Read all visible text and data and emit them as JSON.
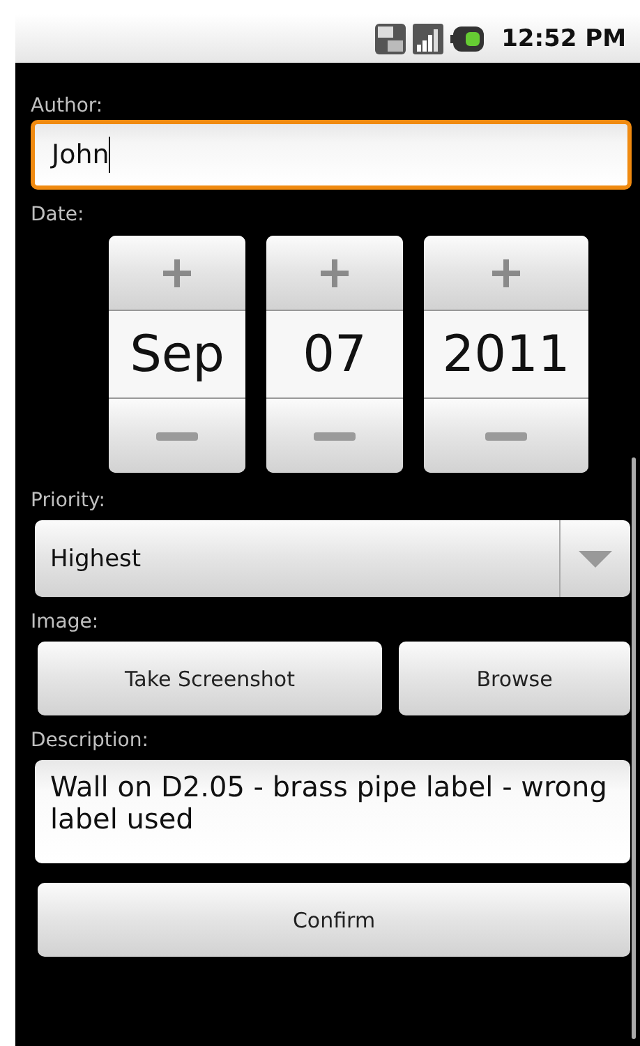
{
  "status_bar": {
    "time": "12:52 PM"
  },
  "author": {
    "label": "Author:",
    "value": "John",
    "focused": true
  },
  "date": {
    "label": "Date:",
    "columns": [
      {
        "value": "Sep"
      },
      {
        "value": "07"
      },
      {
        "value": "2011"
      }
    ]
  },
  "priority": {
    "label": "Priority:",
    "value": "Highest"
  },
  "image": {
    "label": "Image:",
    "buttons": [
      "Take Screenshot",
      "Browse"
    ]
  },
  "description": {
    "label": "Description:",
    "value": "Wall on D2.05 - brass pipe label - wrong label used"
  },
  "confirm_button": "Confirm"
}
